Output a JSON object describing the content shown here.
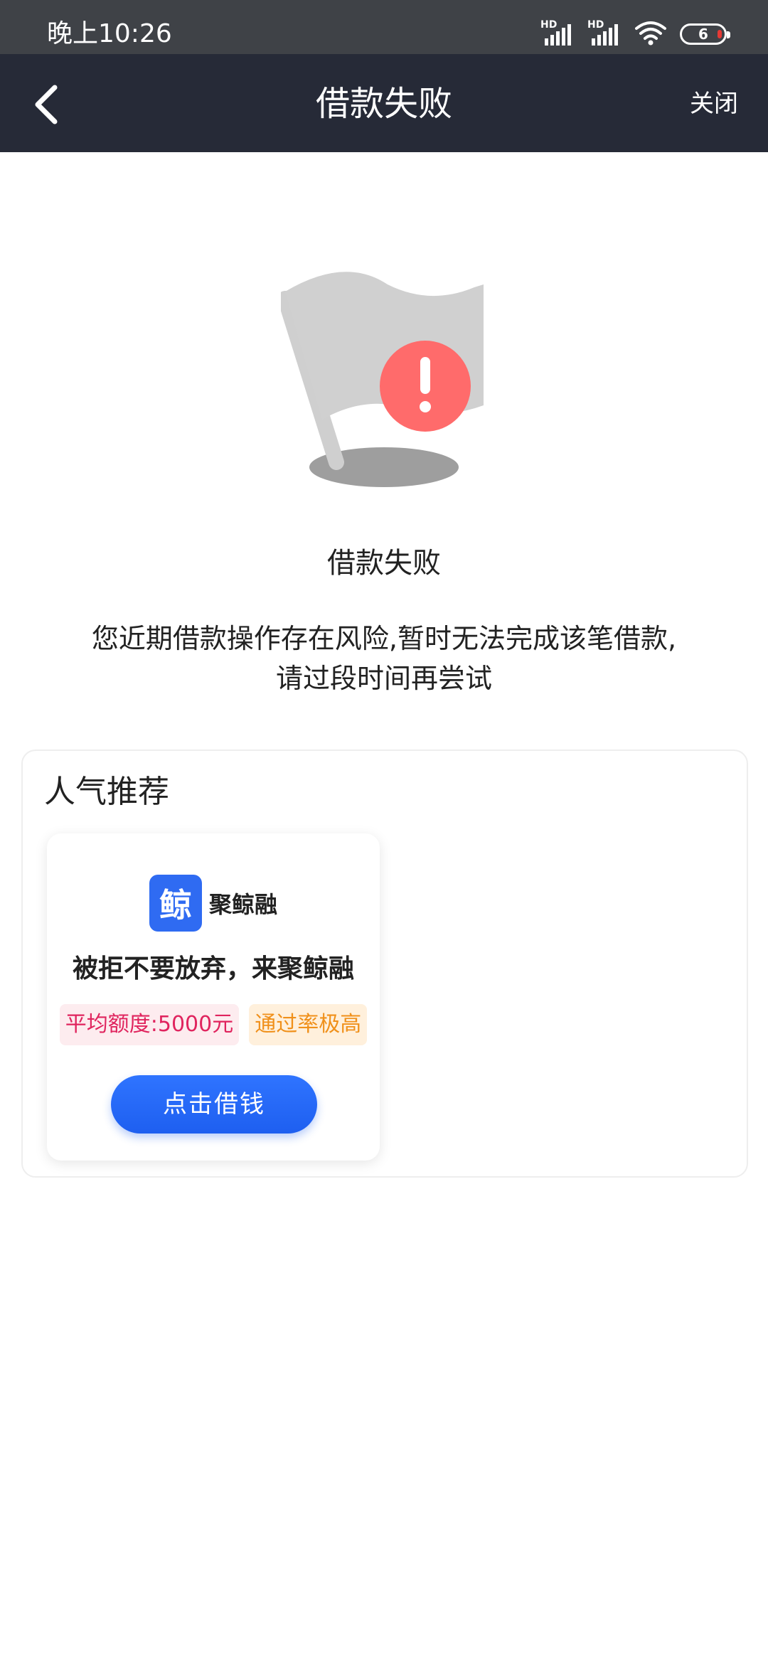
{
  "status_bar": {
    "time": "晚上10:26",
    "signal_1_label": "HD",
    "signal_2_label": "HD",
    "battery_level": "6",
    "icons": [
      "signal-icon",
      "signal-icon",
      "wifi-icon",
      "battery-icon"
    ]
  },
  "nav": {
    "back_icon": "chevron-left-icon",
    "title": "借款失败",
    "close_label": "关闭"
  },
  "result": {
    "illustration_icon": "flag-warning-icon",
    "title": "借款失败",
    "description_line1": "您近期借款操作存在风险,暂时无法完成该笔借款,",
    "description_line2": "请过段时间再尝试"
  },
  "recommend": {
    "title": "人气推荐",
    "products": [
      {
        "logo_char": "鲸",
        "brand_name": "聚鲸融",
        "slogan": "被拒不要放弃，来聚鲸融",
        "tags": [
          "平均额度:5000元",
          "通过率极高"
        ],
        "button_label": "点击借钱"
      }
    ]
  },
  "colors": {
    "status_bar_bg": "#3f4247",
    "nav_bg": "#262a37",
    "accent_blue": "#2f6bf2",
    "warning_red": "#ff6b6b",
    "tag_red": "#e0245e",
    "tag_orange": "#f0901a"
  }
}
